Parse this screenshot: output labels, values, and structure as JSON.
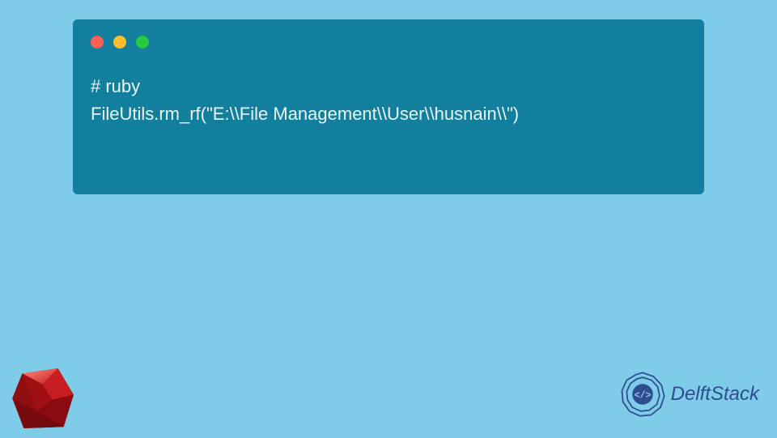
{
  "code": {
    "line1": "# ruby",
    "line2": "FileUtils.rm_rf(\"E:\\\\File Management\\\\User\\\\husnain\\\\\")"
  },
  "branding": {
    "name": "DelftStack"
  },
  "colors": {
    "background": "#7ecce8",
    "window": "#127f9e",
    "dot_red": "#ff5f56",
    "dot_yellow": "#ffbd2e",
    "dot_green": "#27c93f",
    "ruby_red": "#b01117",
    "delft_blue": "#2e4c8f"
  }
}
